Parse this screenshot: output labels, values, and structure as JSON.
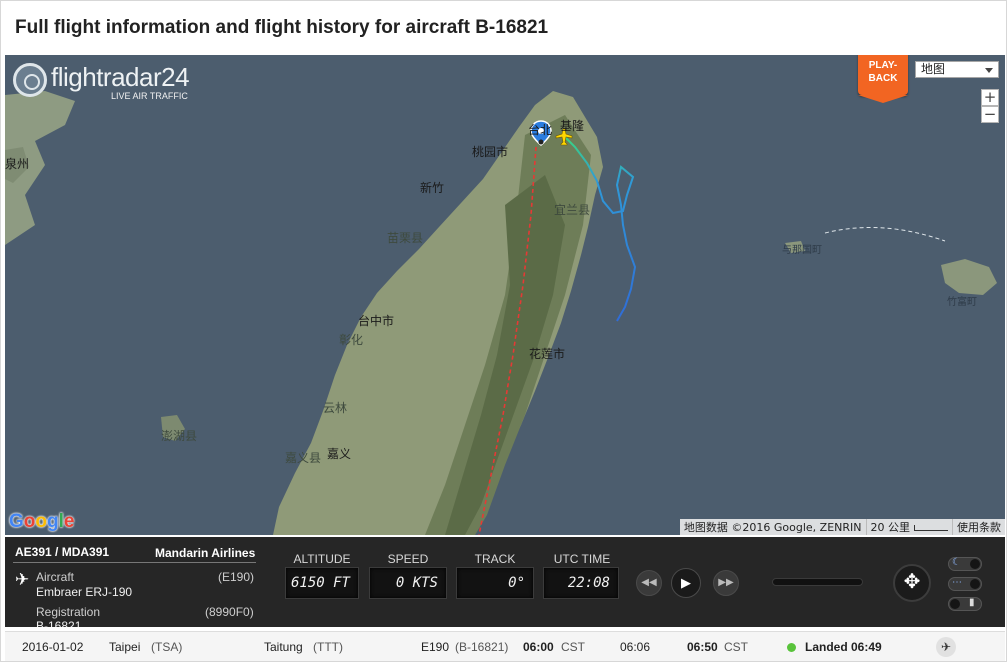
{
  "page": {
    "title": "Full flight information and flight history for aircraft B-16821"
  },
  "logo": {
    "brand": "flightradar24",
    "tagline": "LIVE AIR TRAFFIC"
  },
  "map": {
    "playback_label": "PLAY-\nBACK",
    "map_type": "地图",
    "zoom_in": "+",
    "zoom_out": "−",
    "places": {
      "keelung": "基隆",
      "taipei": "台北",
      "taoyuan": "桃园市",
      "hsinchu": "新竹",
      "yilan": "宜兰县",
      "miaoli": "苗栗县",
      "taichung": "台中市",
      "changhua": "彰化",
      "hualien": "花莲市",
      "yunlin": "云林",
      "chiayi": "嘉义",
      "chiayi_county": "嘉义县",
      "penghu": "澎湖县",
      "quanzhou": "泉州",
      "yonaguni": "与那国町",
      "taketomi": "竹富町"
    },
    "google_logo": "Google",
    "attribution": {
      "data": "地图数据 ©2016 Google, ZENRIN",
      "scale": "20 公里",
      "terms": "使用条款"
    },
    "colors": {
      "track_start": "#3bd97c",
      "track_mid": "#2f9ad8",
      "track_end": "#2f6cd8",
      "route": "#e53935",
      "sea": "#4c5d6e"
    }
  },
  "info": {
    "flight_ids": "AE391 / MDA391",
    "airline": "Mandarin Airlines",
    "aircraft_label": "Aircraft",
    "aircraft_code": "(E190)",
    "aircraft_model": "Embraer ERJ-190",
    "registration_label": "Registration",
    "registration_code": "(8990F0)",
    "registration": "B-16821",
    "altitude_label": "ALTITUDE",
    "altitude": "6150 FT",
    "speed_label": "SPEED",
    "speed": "0 KTS",
    "track_label": "TRACK",
    "track": "0°",
    "utc_label": "UTC TIME",
    "utc": "22:08"
  },
  "history": {
    "date": "2016-01-02",
    "from_city": "Taipei",
    "from_code": "(TSA)",
    "to_city": "Taitung",
    "to_code": "(TTT)",
    "type": "E190",
    "reg": "(B-16821)",
    "std": "06:00",
    "std_tz": "CST",
    "atd": "06:06",
    "sta": "06:50",
    "sta_tz": "CST",
    "status": "Landed 06:49"
  }
}
